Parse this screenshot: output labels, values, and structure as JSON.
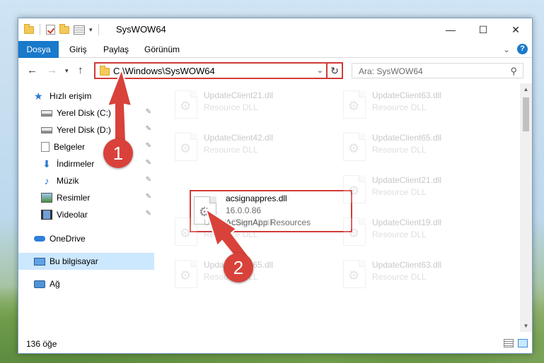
{
  "window": {
    "title": "SysWOW64",
    "controls": {
      "minimize": "—",
      "maximize": "☐",
      "close": "✕"
    }
  },
  "ribbon": {
    "tabs": [
      "Dosya",
      "Giriş",
      "Paylaş",
      "Görünüm"
    ],
    "help": "?",
    "collapse": "⌄"
  },
  "address": {
    "path": "C:\\Windows\\SysWOW64",
    "search_placeholder": "Ara: SysWOW64"
  },
  "sidebar": {
    "items": [
      {
        "label": "Hızlı erişim",
        "icon": "star-icon",
        "pinned": false
      },
      {
        "label": "Yerel Disk (C:)",
        "icon": "drive-icon",
        "pinned": true
      },
      {
        "label": "Yerel Disk (D:)",
        "icon": "drive-icon",
        "pinned": true
      },
      {
        "label": "Belgeler",
        "icon": "documents-icon",
        "pinned": true
      },
      {
        "label": "İndirmeler",
        "icon": "downloads-icon",
        "pinned": true
      },
      {
        "label": "Müzik",
        "icon": "music-icon",
        "pinned": true
      },
      {
        "label": "Resimler",
        "icon": "pictures-icon",
        "pinned": true
      },
      {
        "label": "Videolar",
        "icon": "videos-icon",
        "pinned": true
      },
      {
        "label": "OneDrive",
        "icon": "onedrive-icon",
        "pinned": false
      },
      {
        "label": "Bu bilgisayar",
        "icon": "this-pc-icon",
        "pinned": false,
        "selected": true
      },
      {
        "label": "Ağ",
        "icon": "network-icon",
        "pinned": false
      }
    ],
    "pin_glyph": "📌"
  },
  "files": [
    {
      "name": "UpdateClient21.dll",
      "line2": "Resource DLL",
      "line3": ""
    },
    {
      "name": "UpdateClient63.dll",
      "line2": "Resource DLL",
      "line3": ""
    },
    {
      "name": "UpdateClient42.dll",
      "line2": "Resource DLL",
      "line3": ""
    },
    {
      "name": "UpdateClient65.dll",
      "line2": "Resource DLL",
      "line3": ""
    },
    {
      "name": "acsignappres.dll",
      "line2": "16.0.0.86",
      "line3": "AcSignApp Resources",
      "highlighted": true
    },
    {
      "name": "UpdateClient21.dll",
      "line2": "Resource DLL",
      "line3": ""
    },
    {
      "name": "UpdateClient42.dll",
      "line2": "Resource DLL",
      "line3": ""
    },
    {
      "name": "UpdateClient19.dll",
      "line2": "Resource DLL",
      "line3": ""
    },
    {
      "name": "UpdateClient65.dll",
      "line2": "Resource DLL",
      "line3": ""
    },
    {
      "name": "UpdateClient63.dll",
      "line2": "Resource DLL",
      "line3": ""
    }
  ],
  "status": {
    "item_count": "136 öğe"
  },
  "annotations": {
    "step1": "1",
    "step2": "2",
    "accent": "#d8423a"
  },
  "colors": {
    "file_tab": "#1979ca",
    "highlight_border": "#d23b36",
    "selected_nav": "#cce8ff"
  }
}
